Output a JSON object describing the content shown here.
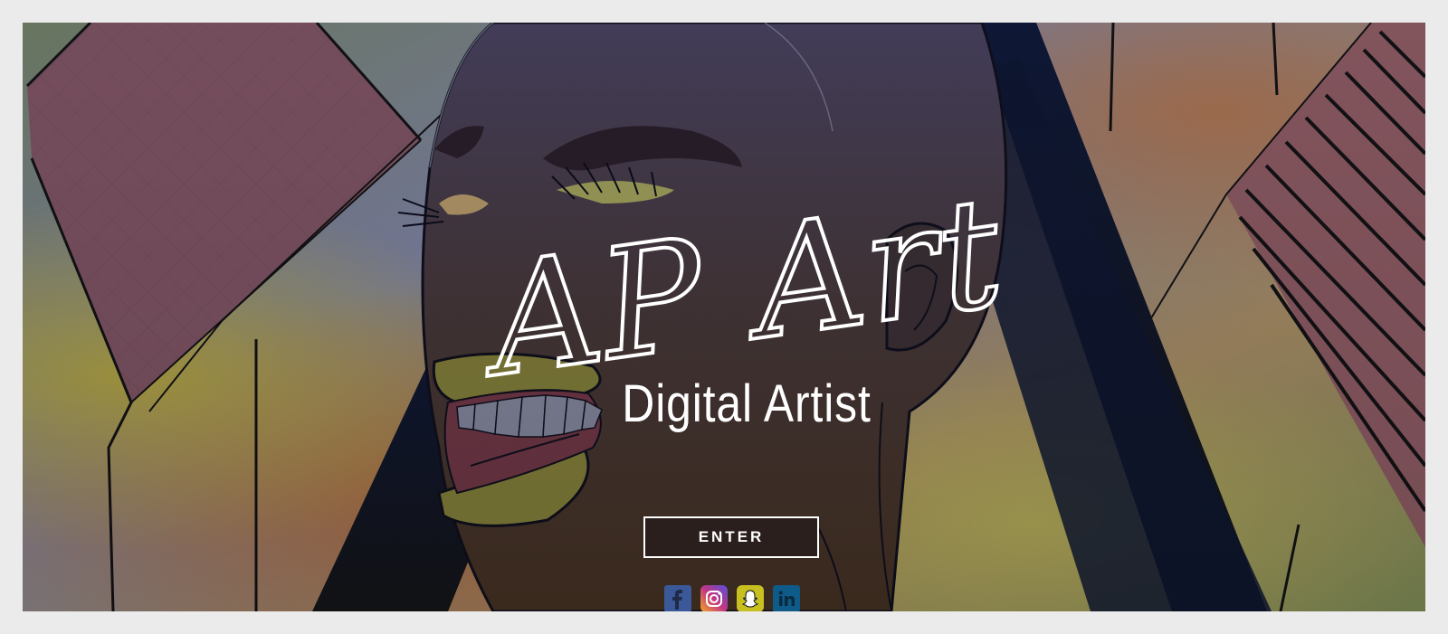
{
  "hero": {
    "logo_text": "AP Art",
    "subtitle": "Digital Artist",
    "enter_label": "ENTER"
  },
  "social": [
    {
      "icon": "facebook-icon",
      "color": "#3b5998"
    },
    {
      "icon": "instagram-icon",
      "color": "#c13584"
    },
    {
      "icon": "snapchat-icon",
      "color": "#fffc00"
    },
    {
      "icon": "linkedin-icon",
      "color": "#0e76a8"
    }
  ],
  "colors": {
    "page_border": "#ebebeb",
    "text": "#ffffff",
    "button_bg": "#2a1f1c"
  }
}
